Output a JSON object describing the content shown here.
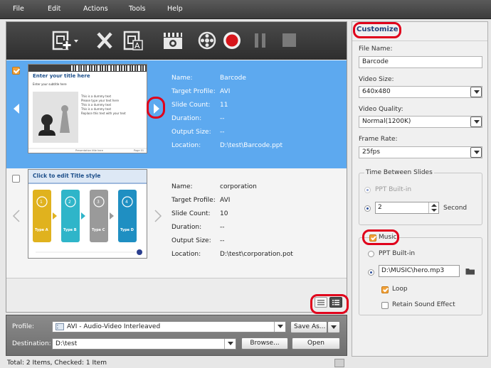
{
  "menu": {
    "file": "File",
    "edit": "Edit",
    "actions": "Actions",
    "tools": "Tools",
    "help": "Help"
  },
  "items": [
    {
      "checked": true,
      "thumb_title": "Enter your title here",
      "thumb_subtitle": "Enter your subtitle here",
      "thumb_bullets": [
        "This is a dummy text",
        "Please type your text here",
        "This is a dummy text",
        "This is a dummy text",
        "Replace this text with your text"
      ],
      "thumb_footer": "Presentation title here",
      "thumb_page": "Page 01",
      "name_label": "Name:",
      "name": "Barcode",
      "profile_label": "Target Profile:",
      "profile": "AVI",
      "slides_label": "Slide Count:",
      "slides": "11",
      "duration_label": "Duration:",
      "duration": "--",
      "size_label": "Output Size:",
      "size": "--",
      "location_label": "Location:",
      "location": "D:\\test\\Barcode.ppt"
    },
    {
      "checked": false,
      "thumb_title": "Click to edit Title style",
      "thumb_types": [
        {
          "num": "1",
          "label": "Type A",
          "color": "#e0b21e"
        },
        {
          "num": "2",
          "label": "Type B",
          "color": "#2fb5c9"
        },
        {
          "num": "3",
          "label": "Type C",
          "color": "#9a9a9a"
        },
        {
          "num": "4",
          "label": "Type D",
          "color": "#1f8fc2"
        }
      ],
      "name_label": "Name:",
      "name": "corporation",
      "profile_label": "Target Profile:",
      "profile": "AVI",
      "slides_label": "Slide Count:",
      "slides": "10",
      "duration_label": "Duration:",
      "duration": "--",
      "size_label": "Output Size:",
      "size": "--",
      "location_label": "Location:",
      "location": "D:\\test\\corporation.pot"
    }
  ],
  "profile_bar": {
    "profile_label": "Profile:",
    "profile_value": "AVI - Audio-Video Interleaved",
    "save_as": "Save As...",
    "destination_label": "Destination:",
    "destination_value": "D:\\test",
    "browse": "Browse...",
    "open": "Open"
  },
  "status": {
    "text": "Total: 2 Items, Checked: 1 Item"
  },
  "customize": {
    "title": "Customize",
    "file_name_label": "File Name:",
    "file_name": "Barcode",
    "video_size_label": "Video Size:",
    "video_size": "640x480",
    "video_quality_label": "Video Quality:",
    "video_quality": "Normal(1200K)",
    "frame_rate_label": "Frame Rate:",
    "frame_rate": "25fps",
    "tbs_title": "Time Between Slides",
    "tbs_builtin": "PPT Built-in",
    "tbs_value": "2",
    "tbs_unit": "Second",
    "music_label": "Music",
    "music_builtin": "PPT Built-in",
    "music_path": "D:\\MUSIC\\hero.mp3",
    "loop_label": "Loop",
    "retain_label": "Retain Sound Effect"
  },
  "colors": {
    "accent": "#5da9ef",
    "highlight": "#e0001b",
    "checkbox": "#f2a23a"
  }
}
